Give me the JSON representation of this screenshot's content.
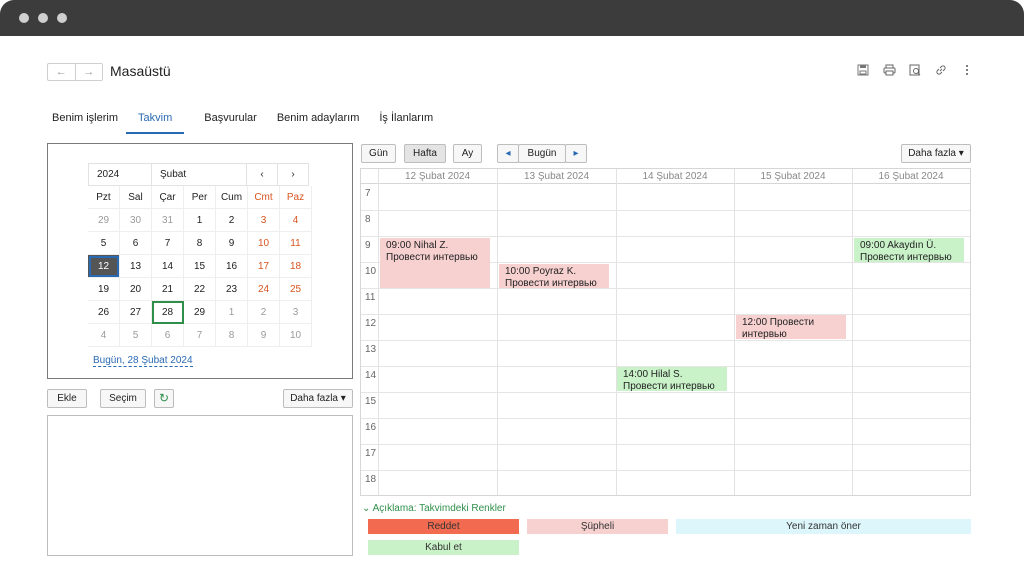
{
  "app": {
    "title": "Masaüstü",
    "back_glyph": "←",
    "fwd_glyph": "→"
  },
  "toolbar_icons": [
    "save-icon",
    "print-icon",
    "preview-icon",
    "link-icon",
    "more-icon"
  ],
  "tabs": [
    {
      "label": "Benim işlerim",
      "active": false
    },
    {
      "label": "Takvim",
      "active": true
    },
    {
      "label": "Başvurular",
      "active": false
    },
    {
      "label": "Benim adaylarım",
      "active": false
    },
    {
      "label": "İş İlanlarım",
      "active": false
    }
  ],
  "mini_calendar": {
    "year": "2024",
    "month": "Şubat",
    "prev": "‹",
    "next": "›",
    "weekdays": [
      "Pzt",
      "Sal",
      "Çar",
      "Per",
      "Cum",
      "Cmt",
      "Paz"
    ],
    "weeks": [
      [
        "29",
        "30",
        "31",
        "1",
        "2",
        "3",
        "4"
      ],
      [
        "5",
        "6",
        "7",
        "8",
        "9",
        "10",
        "11"
      ],
      [
        "12",
        "13",
        "14",
        "15",
        "16",
        "17",
        "18"
      ],
      [
        "19",
        "20",
        "21",
        "22",
        "23",
        "24",
        "25"
      ],
      [
        "26",
        "27",
        "28",
        "29",
        "1",
        "2",
        "3"
      ],
      [
        "4",
        "5",
        "6",
        "7",
        "8",
        "9",
        "10"
      ]
    ],
    "today_label": "Bugün, 28 Şubat 2024"
  },
  "list_toolbar": {
    "add": "Ekle",
    "select": "Seçim",
    "refresh": "↻",
    "more": "Daha fazla ▾"
  },
  "view_toolbar": {
    "day": "Gün",
    "week": "Hafta",
    "month": "Ay",
    "prev": "◂",
    "today": "Bugün",
    "next": "▸",
    "more": "Daha fazla ▾"
  },
  "week_view": {
    "days": [
      "12 Şubat 2024",
      "13 Şubat 2024",
      "14 Şubat 2024",
      "15 Şubat 2024",
      "16 Şubat 2024"
    ],
    "hours": [
      "7",
      "8",
      "9",
      "10",
      "11",
      "12",
      "13",
      "14",
      "15",
      "16",
      "17",
      "18"
    ],
    "events": [
      {
        "text": "09:00 Nihal Z. Провести интервью",
        "color": "#f7d0d0"
      },
      {
        "text": "10:00 Poyraz K. Провести интервью",
        "color": "#f7d0d0"
      },
      {
        "text": "14:00 Hilal S. Провести интервью",
        "color": "#c9f2c9"
      },
      {
        "text": "12:00 Провести интервью",
        "color": "#f7d0d0"
      },
      {
        "text": "09:00 Akaydın Ü. Провести интервью",
        "color": "#c9f2c9"
      }
    ]
  },
  "legend": {
    "title": "Açıklama: Takvimdeki Renkler",
    "chevron": "⌄",
    "items": [
      {
        "label": "Reddet",
        "color": "#f26b50"
      },
      {
        "label": "Şüpheli",
        "color": "#f7d0d0"
      },
      {
        "label": "Yeni zaman öner",
        "color": "#dcf6fb"
      },
      {
        "label": "Kabul et",
        "color": "#c9f2c9"
      }
    ]
  }
}
